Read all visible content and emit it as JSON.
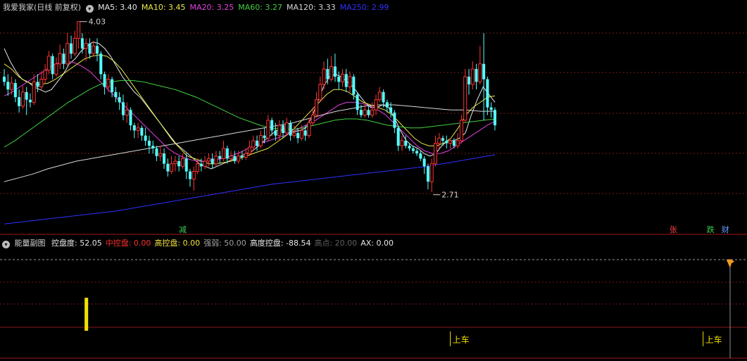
{
  "header": {
    "title": "我爱我家(日线 前复权)",
    "ma": [
      {
        "label": "MA5:",
        "value": "3.40",
        "color": "#e8e8e8"
      },
      {
        "label": "MA10:",
        "value": "3.45",
        "color": "#e8e84a"
      },
      {
        "label": "MA20:",
        "value": "3.25",
        "color": "#e040e0"
      },
      {
        "label": "MA60:",
        "value": "3.27",
        "color": "#40d040"
      },
      {
        "label": "MA120:",
        "value": "3.33",
        "color": "#d8d8d8"
      },
      {
        "label": "MA250:",
        "value": "2.99",
        "color": "#3030ff"
      }
    ]
  },
  "chart_data": {
    "type": "candlestick",
    "high_label": "4.03",
    "low_label": "2.71",
    "ylim": [
      2.55,
      4.1
    ],
    "candles": [
      [
        3.6,
        3.56,
        3.66,
        3.53
      ],
      [
        3.56,
        3.5,
        3.62,
        3.45
      ],
      [
        3.5,
        3.55,
        3.6,
        3.46
      ],
      [
        3.55,
        3.44,
        3.58,
        3.4
      ],
      [
        3.44,
        3.37,
        3.5,
        3.32
      ],
      [
        3.37,
        3.48,
        3.53,
        3.35
      ],
      [
        3.48,
        3.42,
        3.52,
        3.3
      ],
      [
        3.42,
        3.4,
        3.47,
        3.36
      ],
      [
        3.4,
        3.56,
        3.62,
        3.38
      ],
      [
        3.56,
        3.52,
        3.62,
        3.48
      ],
      [
        3.52,
        3.58,
        3.64,
        3.5
      ],
      [
        3.58,
        3.65,
        3.7,
        3.55
      ],
      [
        3.65,
        3.76,
        3.8,
        3.62
      ],
      [
        3.76,
        3.62,
        3.78,
        3.58
      ],
      [
        3.62,
        3.7,
        3.75,
        3.6
      ],
      [
        3.7,
        3.78,
        3.85,
        3.66
      ],
      [
        3.78,
        3.7,
        3.82,
        3.66
      ],
      [
        3.7,
        3.86,
        3.94,
        3.68
      ],
      [
        3.86,
        3.78,
        3.92,
        3.74
      ],
      [
        3.78,
        3.9,
        3.96,
        3.76
      ],
      [
        3.9,
        4.03,
        4.03,
        3.82
      ],
      [
        3.9,
        3.82,
        3.94,
        3.78
      ],
      [
        3.82,
        3.86,
        3.9,
        3.72
      ],
      [
        3.86,
        3.78,
        3.9,
        3.74
      ],
      [
        3.78,
        3.84,
        3.88,
        3.76
      ],
      [
        3.84,
        3.78,
        3.9,
        3.72
      ],
      [
        3.78,
        3.62,
        3.8,
        3.58
      ],
      [
        3.62,
        3.52,
        3.64,
        3.46
      ],
      [
        3.52,
        3.58,
        3.62,
        3.48
      ],
      [
        3.58,
        3.48,
        3.6,
        3.44
      ],
      [
        3.48,
        3.44,
        3.52,
        3.4
      ],
      [
        3.44,
        3.4,
        3.48,
        3.34
      ],
      [
        3.4,
        3.3,
        3.46,
        3.26
      ],
      [
        3.3,
        3.34,
        3.4,
        3.24
      ],
      [
        3.34,
        3.22,
        3.36,
        3.18
      ],
      [
        3.22,
        3.18,
        3.24,
        3.12
      ],
      [
        3.18,
        3.2,
        3.24,
        3.12
      ],
      [
        3.2,
        3.14,
        3.22,
        3.1
      ],
      [
        3.14,
        3.1,
        3.2,
        3.06
      ],
      [
        3.1,
        3.06,
        3.14,
        3.0
      ],
      [
        3.06,
        3.04,
        3.1,
        3.0
      ],
      [
        3.04,
        2.98,
        3.06,
        2.94
      ],
      [
        2.98,
        3.0,
        3.06,
        2.94
      ],
      [
        3.0,
        2.92,
        3.04,
        2.88
      ],
      [
        2.92,
        2.86,
        2.96,
        2.82
      ],
      [
        2.86,
        2.92,
        2.98,
        2.84
      ],
      [
        2.92,
        2.94,
        2.98,
        2.86
      ],
      [
        2.94,
        2.9,
        2.98,
        2.86
      ],
      [
        2.9,
        2.96,
        3.0,
        2.88
      ],
      [
        2.96,
        2.86,
        3.0,
        2.8
      ],
      [
        2.86,
        2.8,
        2.88,
        2.74
      ],
      [
        2.8,
        2.86,
        2.9,
        2.71
      ],
      [
        2.86,
        2.92,
        2.96,
        2.84
      ],
      [
        2.92,
        2.9,
        2.96,
        2.86
      ],
      [
        2.9,
        2.94,
        2.98,
        2.88
      ],
      [
        2.94,
        2.96,
        3.0,
        2.9
      ],
      [
        2.96,
        2.92,
        3.0,
        2.88
      ],
      [
        2.92,
        2.98,
        3.02,
        2.9
      ],
      [
        2.98,
        2.96,
        3.02,
        2.92
      ],
      [
        2.96,
        3.04,
        3.1,
        2.94
      ],
      [
        3.04,
        2.96,
        3.06,
        2.92
      ],
      [
        2.96,
        2.98,
        3.02,
        2.94
      ],
      [
        2.98,
        2.94,
        3.02,
        2.92
      ],
      [
        2.94,
        2.98,
        3.02,
        2.92
      ],
      [
        2.98,
        2.97,
        3.02,
        2.95
      ],
      [
        2.97,
        3.0,
        3.04,
        2.95
      ],
      [
        3.0,
        3.05,
        3.1,
        2.98
      ],
      [
        3.05,
        3.1,
        3.14,
        3.02
      ],
      [
        3.1,
        3.06,
        3.14,
        3.02
      ],
      [
        3.06,
        3.14,
        3.18,
        3.04
      ],
      [
        3.14,
        3.12,
        3.2,
        3.08
      ],
      [
        3.12,
        3.26,
        3.3,
        3.1
      ],
      [
        3.26,
        3.18,
        3.28,
        3.14
      ],
      [
        3.18,
        3.14,
        3.24,
        3.1
      ],
      [
        3.14,
        3.22,
        3.26,
        3.1
      ],
      [
        3.22,
        3.16,
        3.26,
        3.12
      ],
      [
        3.16,
        3.24,
        3.28,
        3.14
      ],
      [
        3.24,
        3.14,
        3.26,
        3.1
      ],
      [
        3.14,
        3.16,
        3.22,
        3.12
      ],
      [
        3.16,
        3.12,
        3.2,
        3.08
      ],
      [
        3.12,
        3.18,
        3.22,
        3.1
      ],
      [
        3.18,
        3.14,
        3.22,
        3.1
      ],
      [
        3.14,
        3.24,
        3.28,
        3.12
      ],
      [
        3.24,
        3.3,
        3.36,
        3.22
      ],
      [
        3.3,
        3.42,
        3.48,
        3.28
      ],
      [
        3.42,
        3.54,
        3.6,
        3.4
      ],
      [
        3.54,
        3.66,
        3.72,
        3.5
      ],
      [
        3.66,
        3.58,
        3.74,
        3.54
      ],
      [
        3.58,
        3.68,
        3.76,
        3.56
      ],
      [
        3.68,
        3.6,
        3.78,
        3.56
      ],
      [
        3.6,
        3.56,
        3.64,
        3.5
      ],
      [
        3.56,
        3.62,
        3.66,
        3.52
      ],
      [
        3.62,
        3.52,
        3.66,
        3.48
      ],
      [
        3.52,
        3.6,
        3.64,
        3.48
      ],
      [
        3.6,
        3.46,
        3.62,
        3.42
      ],
      [
        3.46,
        3.34,
        3.48,
        3.3
      ],
      [
        3.34,
        3.3,
        3.38,
        3.28
      ],
      [
        3.3,
        3.34,
        3.38,
        3.28
      ],
      [
        3.34,
        3.3,
        3.38,
        3.28
      ],
      [
        3.3,
        3.34,
        3.4,
        3.28
      ],
      [
        3.34,
        3.42,
        3.46,
        3.3
      ],
      [
        3.42,
        3.48,
        3.52,
        3.4
      ],
      [
        3.48,
        3.4,
        3.5,
        3.36
      ],
      [
        3.4,
        3.36,
        3.42,
        3.32
      ],
      [
        3.36,
        3.32,
        3.4,
        3.28
      ],
      [
        3.32,
        3.2,
        3.34,
        3.16
      ],
      [
        3.2,
        3.06,
        3.22,
        3.02
      ],
      [
        3.06,
        3.1,
        3.14,
        3.02
      ],
      [
        3.1,
        3.06,
        3.14,
        3.04
      ],
      [
        3.06,
        3.04,
        3.08,
        3.02
      ],
      [
        3.04,
        3.02,
        3.06,
        3.0
      ],
      [
        3.02,
        3.0,
        3.04,
        2.98
      ],
      [
        3.0,
        2.96,
        3.02,
        2.94
      ],
      [
        2.96,
        2.9,
        2.98,
        2.84
      ],
      [
        2.9,
        2.78,
        2.92,
        2.72
      ],
      [
        2.78,
        2.92,
        2.96,
        2.7
      ],
      [
        2.92,
        3.08,
        3.14,
        2.9
      ],
      [
        3.08,
        3.12,
        3.16,
        3.04
      ],
      [
        3.12,
        3.1,
        3.14,
        3.06
      ],
      [
        3.1,
        3.08,
        3.14,
        3.04
      ],
      [
        3.08,
        3.1,
        3.12,
        3.04
      ],
      [
        3.1,
        3.06,
        3.12,
        3.04
      ],
      [
        3.06,
        3.1,
        3.16,
        3.04
      ],
      [
        3.1,
        3.26,
        3.3,
        3.08
      ],
      [
        3.26,
        3.6,
        3.66,
        3.24
      ],
      [
        3.6,
        3.54,
        3.66,
        3.46
      ],
      [
        3.54,
        3.66,
        3.72,
        3.5
      ],
      [
        3.66,
        3.56,
        3.7,
        3.5
      ],
      [
        3.56,
        3.7,
        3.84,
        3.54
      ],
      [
        3.7,
        3.58,
        3.94,
        3.26
      ],
      [
        3.58,
        3.36,
        3.6,
        3.3
      ],
      [
        3.36,
        3.34,
        3.4,
        3.28
      ],
      [
        3.34,
        3.22,
        3.36,
        3.18
      ]
    ],
    "ma_series": [
      {
        "name": "MA5",
        "values": [
          3.82,
          3.72,
          3.64,
          3.58,
          3.56,
          3.52,
          3.5,
          3.48,
          3.5,
          3.56,
          3.62,
          3.7,
          3.74,
          3.8,
          3.84,
          3.87,
          3.86,
          3.82,
          3.76,
          3.68,
          3.6,
          3.54,
          3.48,
          3.44,
          3.38,
          3.32,
          3.26,
          3.2,
          3.14,
          3.08,
          3.04,
          3.0,
          2.96,
          2.92,
          2.9,
          2.88,
          2.9,
          2.92,
          2.94,
          2.96,
          2.98,
          3.0,
          3.02,
          3.06,
          3.1,
          3.14,
          3.18,
          3.18,
          3.16,
          3.17,
          3.18,
          3.2,
          3.28,
          3.4,
          3.52,
          3.6,
          3.62,
          3.6,
          3.56,
          3.52,
          3.46,
          3.4,
          3.36,
          3.36,
          3.38,
          3.36,
          3.28,
          3.18,
          3.1,
          3.06,
          3.04,
          3.0,
          2.98,
          3.0,
          3.06,
          3.1,
          3.1,
          3.12,
          3.16,
          3.3,
          3.42,
          3.52,
          3.46,
          3.4
        ]
      },
      {
        "name": "MA10",
        "values": [
          3.7,
          3.66,
          3.6,
          3.56,
          3.54,
          3.54,
          3.55,
          3.58,
          3.62,
          3.66,
          3.7,
          3.74,
          3.76,
          3.77,
          3.76,
          3.72,
          3.66,
          3.58,
          3.5,
          3.42,
          3.34,
          3.26,
          3.18,
          3.1,
          3.04,
          2.98,
          2.96,
          2.94,
          2.92,
          2.92,
          2.93,
          2.94,
          2.96,
          2.98,
          3.0,
          3.02,
          3.04,
          3.08,
          3.12,
          3.16,
          3.22,
          3.28,
          3.34,
          3.4,
          3.46,
          3.5,
          3.5,
          3.48,
          3.44,
          3.4,
          3.38,
          3.36,
          3.34,
          3.3,
          3.24,
          3.18,
          3.12,
          3.08,
          3.06,
          3.06,
          3.08,
          3.12,
          3.2,
          3.3,
          3.36,
          3.4,
          3.44,
          3.45
        ]
      },
      {
        "name": "MA20",
        "values": [
          3.45,
          3.48,
          3.52,
          3.56,
          3.6,
          3.64,
          3.68,
          3.71,
          3.72,
          3.71,
          3.68,
          3.64,
          3.58,
          3.52,
          3.46,
          3.4,
          3.34,
          3.28,
          3.22,
          3.16,
          3.1,
          3.04,
          3.0,
          2.97,
          2.95,
          2.94,
          2.94,
          2.95,
          2.96,
          2.98,
          3.0,
          3.03,
          3.06,
          3.08,
          3.1,
          3.12,
          3.14,
          3.17,
          3.2,
          3.23,
          3.26,
          3.3,
          3.34,
          3.38,
          3.4,
          3.4,
          3.39,
          3.37,
          3.34,
          3.3,
          3.24,
          3.18,
          3.12,
          3.06,
          3.02,
          3.0,
          3.0,
          3.02,
          3.06,
          3.1,
          3.14,
          3.18,
          3.22,
          3.25
        ]
      },
      {
        "name": "MA60",
        "values": [
          3.05,
          3.1,
          3.16,
          3.22,
          3.28,
          3.34,
          3.4,
          3.45,
          3.5,
          3.54,
          3.56,
          3.57,
          3.57,
          3.56,
          3.54,
          3.52,
          3.5,
          3.47,
          3.44,
          3.4,
          3.36,
          3.32,
          3.28,
          3.25,
          3.22,
          3.2,
          3.19,
          3.19,
          3.2,
          3.22,
          3.24,
          3.26,
          3.27,
          3.27,
          3.26,
          3.24,
          3.22,
          3.21,
          3.2,
          3.2,
          3.21,
          3.22,
          3.23,
          3.24,
          3.25,
          3.26,
          3.27
        ]
      },
      {
        "name": "MA120",
        "values": [
          2.78,
          2.81,
          2.84,
          2.88,
          2.91,
          2.94,
          2.96,
          2.98,
          3.0,
          3.02,
          3.04,
          3.06,
          3.08,
          3.1,
          3.12,
          3.14,
          3.16,
          3.18,
          3.2,
          3.22,
          3.24,
          3.27,
          3.3,
          3.33,
          3.35,
          3.37,
          3.38,
          3.38,
          3.37,
          3.36,
          3.35,
          3.34,
          3.34,
          3.33,
          3.33
        ]
      },
      {
        "name": "MA250",
        "values": [
          2.45,
          2.47,
          2.49,
          2.51,
          2.53,
          2.55,
          2.58,
          2.61,
          2.64,
          2.67,
          2.7,
          2.73,
          2.76,
          2.78,
          2.8,
          2.82,
          2.84,
          2.86,
          2.88,
          2.9,
          2.93,
          2.96,
          2.99
        ]
      }
    ],
    "signals": [
      {
        "text": "减",
        "color": "#3cd050",
        "candle": 48
      },
      {
        "text": "张",
        "color": "#ff4040",
        "candle": 180
      },
      {
        "text": "跌",
        "color": "#3cd050",
        "candle": 190
      },
      {
        "text": "财",
        "color": "#60a0ff",
        "candle": 194
      }
    ]
  },
  "sub": {
    "title": "能量副图",
    "items": [
      {
        "label": "控盘度:",
        "value": "52.05",
        "color": "#e8e8e8"
      },
      {
        "label": "中控盘:",
        "value": "0.00",
        "color": "#ff3030"
      },
      {
        "label": "高控盘:",
        "value": "0.00",
        "color": "#f0e040"
      },
      {
        "label": "强弱:",
        "value": "50.00",
        "color": "#a0a0a0"
      },
      {
        "label": "高度控盘:",
        "value": "-88.54",
        "color": "#e8e8e8"
      },
      {
        "label": "高点:",
        "value": "20.00",
        "color": "#606060"
      },
      {
        "label": "AX:",
        "value": "0.00",
        "color": "#e8e8e8"
      }
    ],
    "energy_bar": {
      "candle": 22,
      "value": 52.05
    },
    "signals": [
      {
        "text": "上车",
        "candle": 120
      },
      {
        "text": "上车",
        "candle": 188
      }
    ]
  },
  "colors": {
    "up": "#ff3333",
    "down": "#54ffff",
    "grid": "#7a1a1a",
    "divider": "#a01818"
  }
}
